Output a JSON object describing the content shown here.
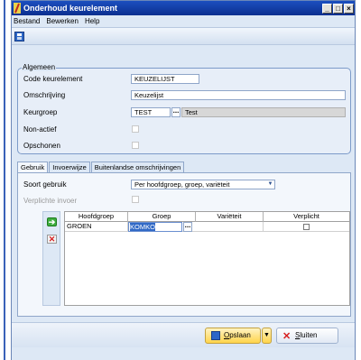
{
  "window": {
    "title": "Onderhoud keurelement",
    "controls": [
      "_",
      "□",
      "×"
    ]
  },
  "menu": [
    "Bestand",
    "Bewerken",
    "Help"
  ],
  "toolbar": {
    "save_icon": "save-icon"
  },
  "general": {
    "group_title": "Algemeen",
    "fields": {
      "code_label": "Code keurelement",
      "code_value": "KEUZELIJST",
      "omschrijving_label": "Omschrijving",
      "omschrijving_value": "Keuzelijst",
      "keurgroep_label": "Keurgroep",
      "keurgroep_value": "TEST",
      "keurgroep_desc": "Test",
      "nonactief_label": "Non-actief",
      "opschonen_label": "Opschonen"
    }
  },
  "tabs": [
    "Gebruik",
    "Invoerwijze",
    "Buitenlandse omschrijvingen"
  ],
  "usage": {
    "soort_label": "Soort gebruik",
    "soort_value": "Per hoofdgroep, groep, variëteit",
    "verplichte_label": "Verplichte invoer"
  },
  "grid": {
    "columns": [
      "Hoofdgroep",
      "Groep",
      "Variëteit",
      "Verplicht"
    ],
    "rows": [
      {
        "hoofdgroep": "GROEN",
        "groep": "KOMKO",
        "varieteit": "",
        "verplicht": false
      }
    ]
  },
  "buttons": {
    "opslaan_prefix": "",
    "opslaan_underlined": "O",
    "opslaan_rest": "pslaan",
    "sluiten_underlined": "S",
    "sluiten_rest": "luiten"
  },
  "colors": {
    "title_bar": "#1c4fbf",
    "accent_yellow": "#ffd44a",
    "window_bg": "#dde8f5"
  }
}
